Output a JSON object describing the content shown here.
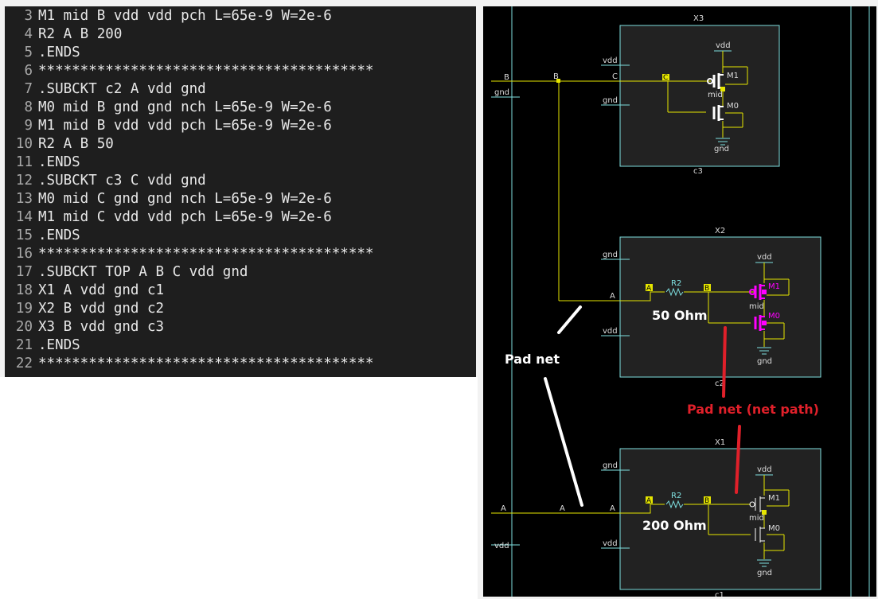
{
  "editor": {
    "lines": [
      {
        "n": "3",
        "text": "M1 mid B vdd vdd pch L=65e-9 W=2e-6"
      },
      {
        "n": "4",
        "text": "R2 A B 200"
      },
      {
        "n": "5",
        "text": ".ENDS"
      },
      {
        "n": "6",
        "text": "****************************************"
      },
      {
        "n": "7",
        "text": ".SUBCKT c2 A vdd gnd"
      },
      {
        "n": "8",
        "text": "M0 mid B gnd gnd nch L=65e-9 W=2e-6"
      },
      {
        "n": "9",
        "text": "M1 mid B vdd vdd pch L=65e-9 W=2e-6"
      },
      {
        "n": "10",
        "text": "R2 A B 50"
      },
      {
        "n": "11",
        "text": ".ENDS"
      },
      {
        "n": "12",
        "text": ".SUBCKT c3 C vdd gnd"
      },
      {
        "n": "13",
        "text": "M0 mid C gnd gnd nch L=65e-9 W=2e-6"
      },
      {
        "n": "14",
        "text": "M1 mid C vdd vdd pch L=65e-9 W=2e-6"
      },
      {
        "n": "15",
        "text": ".ENDS"
      },
      {
        "n": "16",
        "text": "****************************************"
      },
      {
        "n": "17",
        "text": ".SUBCKT TOP A B C vdd gnd"
      },
      {
        "n": "18",
        "text": "X1 A vdd gnd c1"
      },
      {
        "n": "19",
        "text": "X2 B vdd gnd c2"
      },
      {
        "n": "20",
        "text": "X3 B vdd gnd c3"
      },
      {
        "n": "21",
        "text": ".ENDS"
      },
      {
        "n": "22",
        "text": "****************************************"
      }
    ]
  },
  "schematic": {
    "x3": {
      "name": "X3",
      "cell": "c3",
      "vdd": "vdd",
      "gnd": "gnd",
      "port": "C",
      "net": "C",
      "vdd_sup": "vdd",
      "gnd_sup": "gnd",
      "m1": "M1",
      "m0": "M0",
      "mid": "mid"
    },
    "x2": {
      "name": "X2",
      "cell": "c2",
      "gnd": "gnd",
      "vdd": "vdd",
      "port": "A",
      "net_a": "A",
      "net_b": "B",
      "res": "R2",
      "vdd_sup": "vdd",
      "gnd_sup": "gnd",
      "m1": "M1",
      "m0": "M0",
      "mid": "mid"
    },
    "x1": {
      "name": "X1",
      "cell": "c1",
      "gnd": "gnd",
      "vdd": "vdd",
      "port": "A",
      "net_a": "A",
      "net_b": "B",
      "res": "R2",
      "vdd_sup": "vdd",
      "gnd_sup": "gnd",
      "m1": "M1",
      "m0": "M0",
      "mid": "mid"
    },
    "top_pins": {
      "b": "B",
      "gnd": "gnd",
      "a": "A",
      "vdd": "vdd"
    },
    "net_labels": {
      "b": "B",
      "a": "A"
    },
    "annotations": {
      "ohm_50": "50 Ohm",
      "ohm_200": "200 Ohm",
      "pad_net": "Pad net",
      "pad_net_path": "Pad net (net path)"
    },
    "colors": {
      "wire": "#e6e600",
      "highlight": "#ff00ff",
      "annotation_red": "#e0202a",
      "instance_outline": "#7fe0e0"
    }
  }
}
